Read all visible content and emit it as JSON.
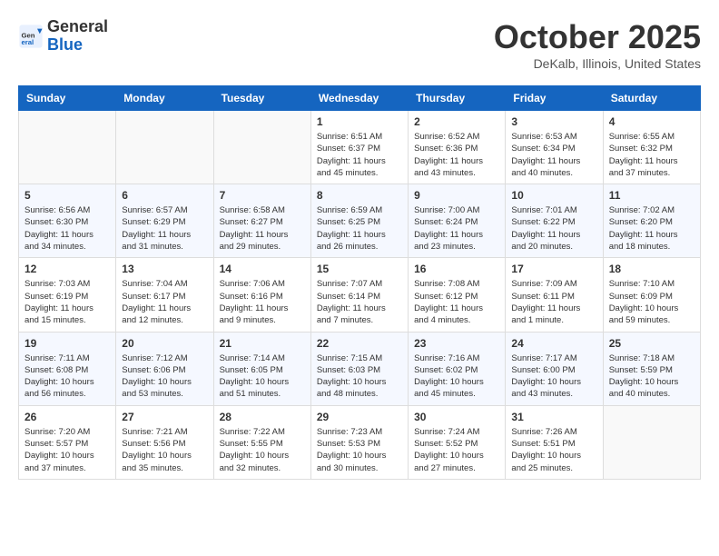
{
  "header": {
    "logo_general": "General",
    "logo_blue": "Blue",
    "month_title": "October 2025",
    "location": "DeKalb, Illinois, United States"
  },
  "days_of_week": [
    "Sunday",
    "Monday",
    "Tuesday",
    "Wednesday",
    "Thursday",
    "Friday",
    "Saturday"
  ],
  "weeks": [
    [
      {
        "day": "",
        "info": ""
      },
      {
        "day": "",
        "info": ""
      },
      {
        "day": "",
        "info": ""
      },
      {
        "day": "1",
        "info": "Sunrise: 6:51 AM\nSunset: 6:37 PM\nDaylight: 11 hours and 45 minutes."
      },
      {
        "day": "2",
        "info": "Sunrise: 6:52 AM\nSunset: 6:36 PM\nDaylight: 11 hours and 43 minutes."
      },
      {
        "day": "3",
        "info": "Sunrise: 6:53 AM\nSunset: 6:34 PM\nDaylight: 11 hours and 40 minutes."
      },
      {
        "day": "4",
        "info": "Sunrise: 6:55 AM\nSunset: 6:32 PM\nDaylight: 11 hours and 37 minutes."
      }
    ],
    [
      {
        "day": "5",
        "info": "Sunrise: 6:56 AM\nSunset: 6:30 PM\nDaylight: 11 hours and 34 minutes."
      },
      {
        "day": "6",
        "info": "Sunrise: 6:57 AM\nSunset: 6:29 PM\nDaylight: 11 hours and 31 minutes."
      },
      {
        "day": "7",
        "info": "Sunrise: 6:58 AM\nSunset: 6:27 PM\nDaylight: 11 hours and 29 minutes."
      },
      {
        "day": "8",
        "info": "Sunrise: 6:59 AM\nSunset: 6:25 PM\nDaylight: 11 hours and 26 minutes."
      },
      {
        "day": "9",
        "info": "Sunrise: 7:00 AM\nSunset: 6:24 PM\nDaylight: 11 hours and 23 minutes."
      },
      {
        "day": "10",
        "info": "Sunrise: 7:01 AM\nSunset: 6:22 PM\nDaylight: 11 hours and 20 minutes."
      },
      {
        "day": "11",
        "info": "Sunrise: 7:02 AM\nSunset: 6:20 PM\nDaylight: 11 hours and 18 minutes."
      }
    ],
    [
      {
        "day": "12",
        "info": "Sunrise: 7:03 AM\nSunset: 6:19 PM\nDaylight: 11 hours and 15 minutes."
      },
      {
        "day": "13",
        "info": "Sunrise: 7:04 AM\nSunset: 6:17 PM\nDaylight: 11 hours and 12 minutes."
      },
      {
        "day": "14",
        "info": "Sunrise: 7:06 AM\nSunset: 6:16 PM\nDaylight: 11 hours and 9 minutes."
      },
      {
        "day": "15",
        "info": "Sunrise: 7:07 AM\nSunset: 6:14 PM\nDaylight: 11 hours and 7 minutes."
      },
      {
        "day": "16",
        "info": "Sunrise: 7:08 AM\nSunset: 6:12 PM\nDaylight: 11 hours and 4 minutes."
      },
      {
        "day": "17",
        "info": "Sunrise: 7:09 AM\nSunset: 6:11 PM\nDaylight: 11 hours and 1 minute."
      },
      {
        "day": "18",
        "info": "Sunrise: 7:10 AM\nSunset: 6:09 PM\nDaylight: 10 hours and 59 minutes."
      }
    ],
    [
      {
        "day": "19",
        "info": "Sunrise: 7:11 AM\nSunset: 6:08 PM\nDaylight: 10 hours and 56 minutes."
      },
      {
        "day": "20",
        "info": "Sunrise: 7:12 AM\nSunset: 6:06 PM\nDaylight: 10 hours and 53 minutes."
      },
      {
        "day": "21",
        "info": "Sunrise: 7:14 AM\nSunset: 6:05 PM\nDaylight: 10 hours and 51 minutes."
      },
      {
        "day": "22",
        "info": "Sunrise: 7:15 AM\nSunset: 6:03 PM\nDaylight: 10 hours and 48 minutes."
      },
      {
        "day": "23",
        "info": "Sunrise: 7:16 AM\nSunset: 6:02 PM\nDaylight: 10 hours and 45 minutes."
      },
      {
        "day": "24",
        "info": "Sunrise: 7:17 AM\nSunset: 6:00 PM\nDaylight: 10 hours and 43 minutes."
      },
      {
        "day": "25",
        "info": "Sunrise: 7:18 AM\nSunset: 5:59 PM\nDaylight: 10 hours and 40 minutes."
      }
    ],
    [
      {
        "day": "26",
        "info": "Sunrise: 7:20 AM\nSunset: 5:57 PM\nDaylight: 10 hours and 37 minutes."
      },
      {
        "day": "27",
        "info": "Sunrise: 7:21 AM\nSunset: 5:56 PM\nDaylight: 10 hours and 35 minutes."
      },
      {
        "day": "28",
        "info": "Sunrise: 7:22 AM\nSunset: 5:55 PM\nDaylight: 10 hours and 32 minutes."
      },
      {
        "day": "29",
        "info": "Sunrise: 7:23 AM\nSunset: 5:53 PM\nDaylight: 10 hours and 30 minutes."
      },
      {
        "day": "30",
        "info": "Sunrise: 7:24 AM\nSunset: 5:52 PM\nDaylight: 10 hours and 27 minutes."
      },
      {
        "day": "31",
        "info": "Sunrise: 7:26 AM\nSunset: 5:51 PM\nDaylight: 10 hours and 25 minutes."
      },
      {
        "day": "",
        "info": ""
      }
    ]
  ]
}
